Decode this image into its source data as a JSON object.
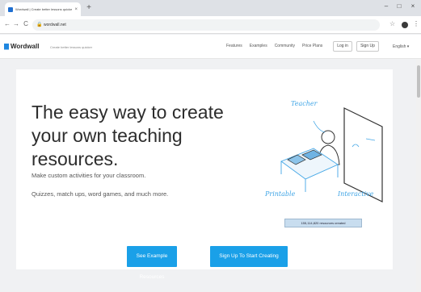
{
  "browser": {
    "tab_title": "Wordwall | Create better lessons quicker",
    "tab_close": "×",
    "new_tab": "+",
    "minimize": "–",
    "maximize": "□",
    "close": "×",
    "back": "←",
    "forward": "→",
    "reload": "C",
    "url": "wordwall.net",
    "lock": "🔒",
    "star": "☆",
    "menu": "⋮"
  },
  "site": {
    "logo": "Wordwall",
    "tagline": "Create better lessons quicker",
    "nav": [
      "Features",
      "Examples",
      "Community",
      "Price Plans"
    ],
    "login": "Log in",
    "signup": "Sign Up",
    "language": "English ▾"
  },
  "hero": {
    "headline": "The easy way to create your own teaching resources.",
    "desc1": "Make custom activities for your classroom.",
    "desc2": "Quizzes, match ups, word games, and much more.",
    "btn_examples": "See Example Resources",
    "btn_signup": "Sign Up To Start Creating",
    "counter": "155,114,820 resources created",
    "label_teacher": "Teacher",
    "label_printable": "Printable",
    "label_interactive": "Interactive"
  },
  "colors": {
    "accent": "#1aa0e8",
    "illustration": "#42a6e6"
  }
}
